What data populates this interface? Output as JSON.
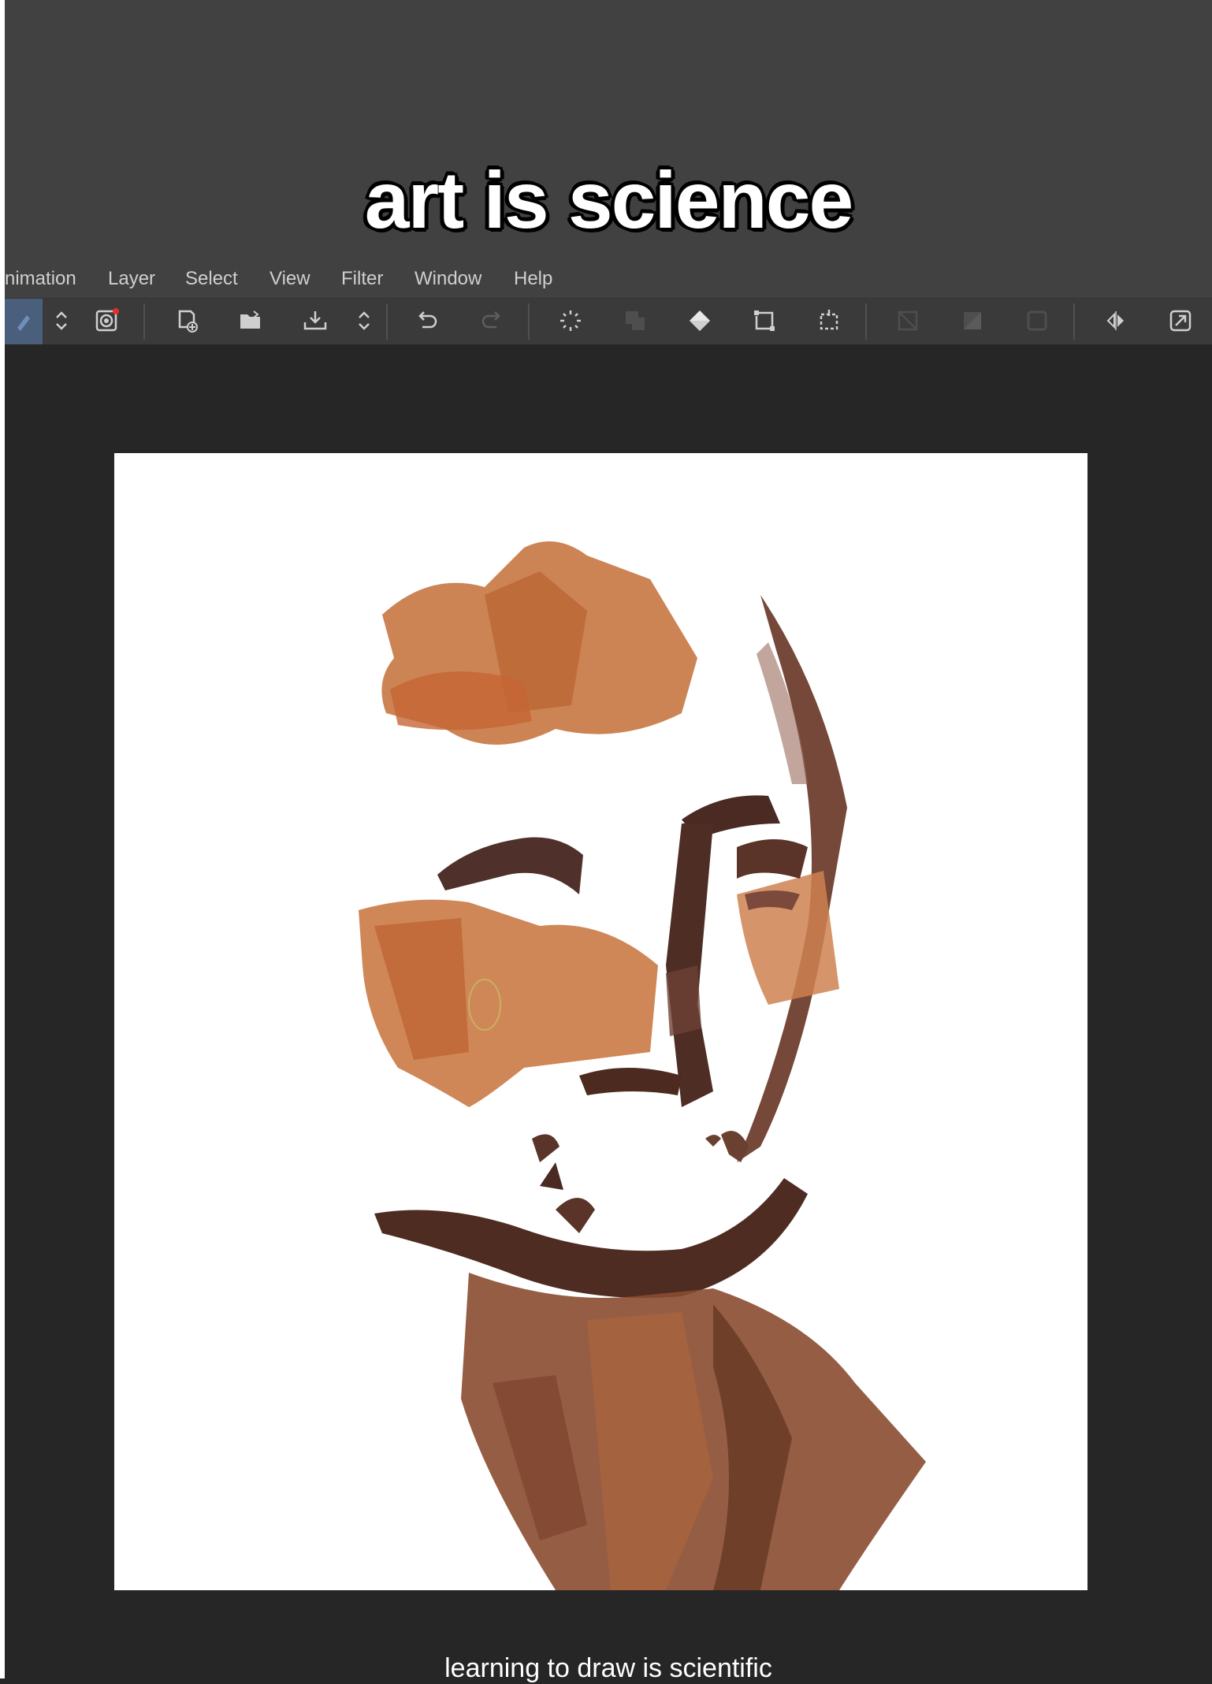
{
  "overlay": {
    "title": "art is science",
    "caption": "learning to draw is scientific"
  },
  "menu": [
    "nimation",
    "Layer",
    "Select",
    "View",
    "Filter",
    "Window",
    "Help"
  ],
  "toolbar": {
    "tools": [
      "pen-tool-icon",
      "sub-tool-switch-icon",
      "layer-target-icon",
      "new-canvas-icon",
      "open-file-icon",
      "save-icon",
      "save-options-icon",
      "undo-icon",
      "redo-icon",
      "loading-spinner-icon",
      "copy-merge-icon",
      "fill-icon",
      "transform-icon",
      "crop-icon",
      "clear-selection-icon",
      "fill-selection-icon",
      "selection-border-icon",
      "flip-horizontal-icon",
      "fullscreen-icon"
    ]
  },
  "colors": {
    "ui_dark": "#262626",
    "ui_bar": "#414141",
    "canvas": "#ffffff",
    "paint_orange": "#c8703c",
    "paint_brown": "#5a3424",
    "paint_mid": "#8a4c30"
  }
}
